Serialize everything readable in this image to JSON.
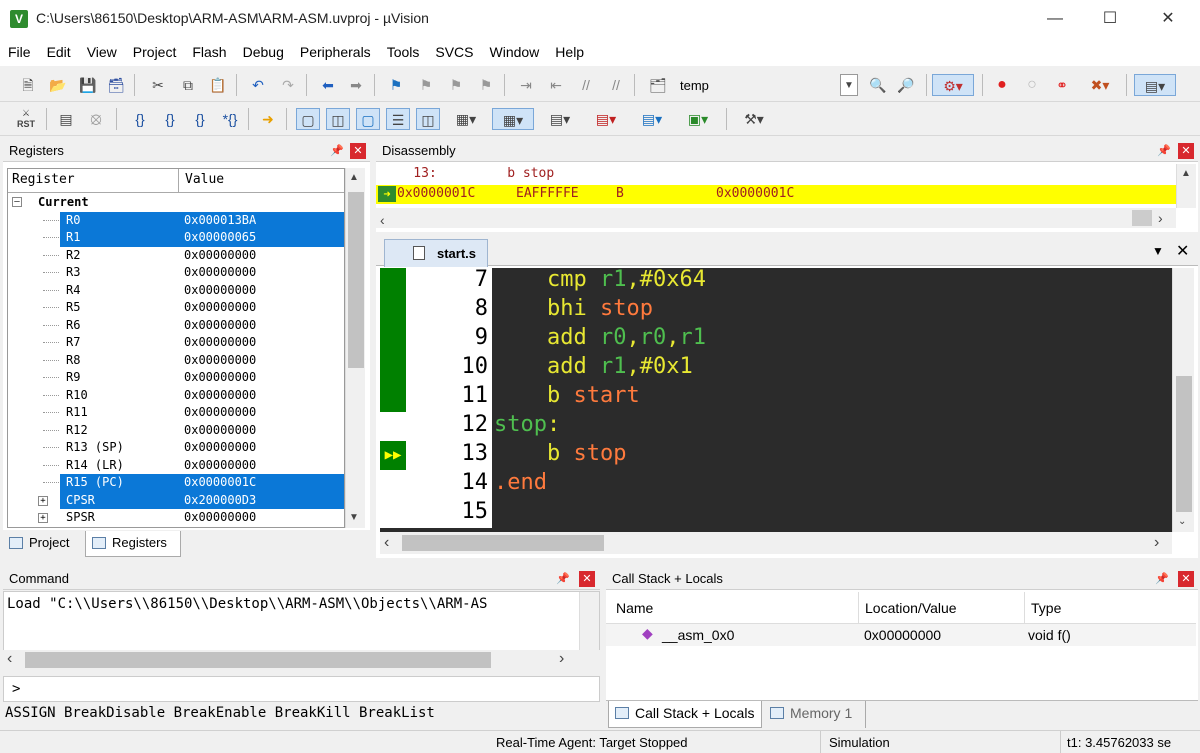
{
  "window": {
    "title": "C:\\Users\\86150\\Desktop\\ARM-ASM\\ARM-ASM.uvproj - µVision",
    "app_icon": "V"
  },
  "menu": [
    "File",
    "Edit",
    "View",
    "Project",
    "Flash",
    "Debug",
    "Peripherals",
    "Tools",
    "SVCS",
    "Window",
    "Help"
  ],
  "toolbar1": {
    "target_label": "temp"
  },
  "registers": {
    "title": "Registers",
    "col_register": "Register",
    "col_value": "Value",
    "group": "Current",
    "rows": [
      {
        "name": "R0",
        "value": "0x000013BA",
        "selected": true
      },
      {
        "name": "R1",
        "value": "0x00000065",
        "selected": true
      },
      {
        "name": "R2",
        "value": "0x00000000"
      },
      {
        "name": "R3",
        "value": "0x00000000"
      },
      {
        "name": "R4",
        "value": "0x00000000"
      },
      {
        "name": "R5",
        "value": "0x00000000"
      },
      {
        "name": "R6",
        "value": "0x00000000"
      },
      {
        "name": "R7",
        "value": "0x00000000"
      },
      {
        "name": "R8",
        "value": "0x00000000"
      },
      {
        "name": "R9",
        "value": "0x00000000"
      },
      {
        "name": "R10",
        "value": "0x00000000"
      },
      {
        "name": "R11",
        "value": "0x00000000"
      },
      {
        "name": "R12",
        "value": "0x00000000"
      },
      {
        "name": "R13 (SP)",
        "value": "0x00000000"
      },
      {
        "name": "R14 (LR)",
        "value": "0x00000000"
      },
      {
        "name": "R15 (PC)",
        "value": "0x0000001C",
        "selected": true
      },
      {
        "name": "CPSR",
        "value": "0x200000D3",
        "selected": true,
        "expandable": true
      },
      {
        "name": "SPSR",
        "value": "0x00000000",
        "expandable": true
      }
    ],
    "tabs": [
      "Project",
      "Registers"
    ]
  },
  "disassembly": {
    "title": "Disassembly",
    "line1": "    13:         b stop",
    "line2_addr": "0x0000001C",
    "line2_opcode": "EAFFFFFE",
    "line2_mnemonic": "B",
    "line2_target": "0x0000001C"
  },
  "editor": {
    "tab": "start.s",
    "lines": [
      {
        "n": "7",
        "tokens": [
          [
            "    cmp ",
            "kw"
          ],
          [
            "r1",
            "reg"
          ],
          [
            ",#0x64",
            "num"
          ]
        ],
        "covered": true
      },
      {
        "n": "8",
        "tokens": [
          [
            "    bhi ",
            "kw"
          ],
          [
            "stop",
            "lbl"
          ]
        ],
        "covered": true
      },
      {
        "n": "9",
        "tokens": [
          [
            "    add ",
            "kw"
          ],
          [
            "r0",
            "reg"
          ],
          [
            ",",
            "kw"
          ],
          [
            "r0",
            "reg"
          ],
          [
            ",",
            "kw"
          ],
          [
            "r1",
            "reg"
          ]
        ],
        "covered": true
      },
      {
        "n": "10",
        "tokens": [
          [
            "    add ",
            "kw"
          ],
          [
            "r1",
            "reg"
          ],
          [
            ",#0x1",
            "num"
          ]
        ],
        "covered": true
      },
      {
        "n": "11",
        "tokens": [
          [
            "    b ",
            "kw"
          ],
          [
            "start",
            "lbl"
          ]
        ],
        "covered": true
      },
      {
        "n": "12",
        "tokens": [
          [
            "stop",
            "lblg"
          ],
          [
            ":",
            "kw"
          ]
        ]
      },
      {
        "n": "13",
        "tokens": [
          [
            "    b ",
            "kw"
          ],
          [
            "stop",
            "lbl"
          ]
        ],
        "current": true
      },
      {
        "n": "14",
        "tokens": [
          [
            ".end",
            "dir"
          ]
        ]
      },
      {
        "n": "15",
        "tokens": []
      }
    ]
  },
  "command": {
    "title": "Command",
    "output": "Load \"C:\\\\Users\\\\86150\\\\Desktop\\\\ARM-ASM\\\\Objects\\\\ARM-AS",
    "prompt": ">",
    "hint": "ASSIGN BreakDisable BreakEnable BreakKill BreakList"
  },
  "callstack": {
    "title": "Call Stack + Locals",
    "col_name": "Name",
    "col_location": "Location/Value",
    "col_type": "Type",
    "rows": [
      {
        "name": "__asm_0x0",
        "location": "0x00000000",
        "type": "void f()"
      }
    ],
    "tabs": [
      "Call Stack + Locals",
      "Memory 1"
    ]
  },
  "status": {
    "agent": "Real-Time Agent: Target Stopped",
    "mode": "Simulation",
    "time": "t1: 3.45762033 se"
  },
  "colors": {
    "selection": "#0b78d7",
    "highlight": "#ffff00",
    "coverage": "#008000",
    "editor_bg": "#2b2b2b"
  }
}
